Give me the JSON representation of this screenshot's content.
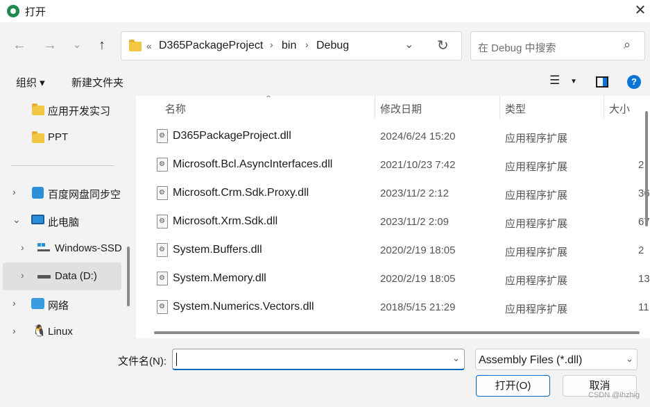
{
  "window": {
    "title": "打开"
  },
  "nav": {
    "breadcrumb": [
      "D365PackageProject",
      "bin",
      "Debug"
    ],
    "overflow": "«",
    "search_placeholder": "在 Debug 中搜索"
  },
  "toolbar": {
    "organize": "组织 ▾",
    "new_folder": "新建文件夹"
  },
  "sidebar": {
    "quick": [
      {
        "label": "应用开发实习"
      },
      {
        "label": "PPT"
      }
    ],
    "tree": [
      {
        "label": "百度网盘同步空",
        "expanded": false
      },
      {
        "label": "此电脑",
        "expanded": true
      },
      {
        "label": "Windows-SSD",
        "expanded": false
      },
      {
        "label": "Data (D:)",
        "expanded": false,
        "selected": true
      },
      {
        "label": "网络",
        "expanded": false
      },
      {
        "label": "Linux",
        "expanded": false
      }
    ]
  },
  "columns": {
    "name": "名称",
    "date": "修改日期",
    "type": "类型",
    "size": "大小"
  },
  "files": [
    {
      "name": "D365PackageProject.dll",
      "date": "2024/6/24 15:20",
      "type": "应用程序扩展",
      "size": ""
    },
    {
      "name": "Microsoft.Bcl.AsyncInterfaces.dll",
      "date": "2021/10/23 7:42",
      "type": "应用程序扩展",
      "size": "2"
    },
    {
      "name": "Microsoft.Crm.Sdk.Proxy.dll",
      "date": "2023/11/2 2:12",
      "type": "应用程序扩展",
      "size": "36"
    },
    {
      "name": "Microsoft.Xrm.Sdk.dll",
      "date": "2023/11/2 2:09",
      "type": "应用程序扩展",
      "size": "67"
    },
    {
      "name": "System.Buffers.dll",
      "date": "2020/2/19 18:05",
      "type": "应用程序扩展",
      "size": "2"
    },
    {
      "name": "System.Memory.dll",
      "date": "2020/2/19 18:05",
      "type": "应用程序扩展",
      "size": "13"
    },
    {
      "name": "System.Numerics.Vectors.dll",
      "date": "2018/5/15 21:29",
      "type": "应用程序扩展",
      "size": "11"
    }
  ],
  "footer": {
    "filename_label": "文件名(N):",
    "filename_value": "",
    "filter": "Assembly Files (*.dll)",
    "open": "打开(O)",
    "cancel": "取消",
    "watermark": "CSDN @ihzhig"
  }
}
